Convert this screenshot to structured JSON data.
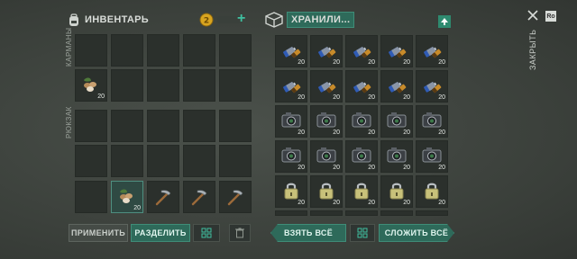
{
  "inventory": {
    "title": "ИНВЕНТАРЬ",
    "coin_count": "",
    "pockets_label": "КАРМАНЫ",
    "backpack_label": "РЮКЗАК"
  },
  "storage": {
    "title": "ХРАНИЛИ..."
  },
  "close": {
    "label": "ЗАКРЫТЬ",
    "badge": "Ro"
  },
  "left_buttons": {
    "apply": "ПРИМЕНИТЬ",
    "split": "РАЗДЕЛИТЬ"
  },
  "right_buttons": {
    "take_all": "ВЗЯТЬ ВСЁ",
    "stack_all": "СЛОЖИТЬ ВСЁ"
  },
  "pocket_item": {
    "icon": "seeds-icon",
    "qty": "20"
  },
  "backpack_items": [
    {
      "icon": "seeds-icon",
      "qty": "20",
      "selected": true
    },
    {
      "icon": "pickaxe-icon",
      "qty": "",
      "selected": false
    },
    {
      "icon": "pickaxe-icon",
      "qty": "",
      "selected": false
    },
    {
      "icon": "pickaxe-icon",
      "qty": "",
      "selected": false
    }
  ],
  "storage_rows": [
    {
      "icon": "battery-icon",
      "qtys": [
        "20",
        "20",
        "20",
        "20",
        "20"
      ]
    },
    {
      "icon": "battery-icon",
      "qtys": [
        "20",
        "20",
        "20",
        "20",
        "20"
      ]
    },
    {
      "icon": "camera-icon",
      "qtys": [
        "20",
        "20",
        "20",
        "20",
        "20"
      ]
    },
    {
      "icon": "camera-icon",
      "qtys": [
        "20",
        "20",
        "20",
        "20",
        "20"
      ]
    },
    {
      "icon": "padlock-icon",
      "qtys": [
        "20",
        "20",
        "20",
        "20",
        "20"
      ]
    }
  ],
  "colors": {
    "accent": "#2e6a5a",
    "slot": "#2b302c",
    "selected": "#2f4a43",
    "coin": "#d9a520"
  }
}
